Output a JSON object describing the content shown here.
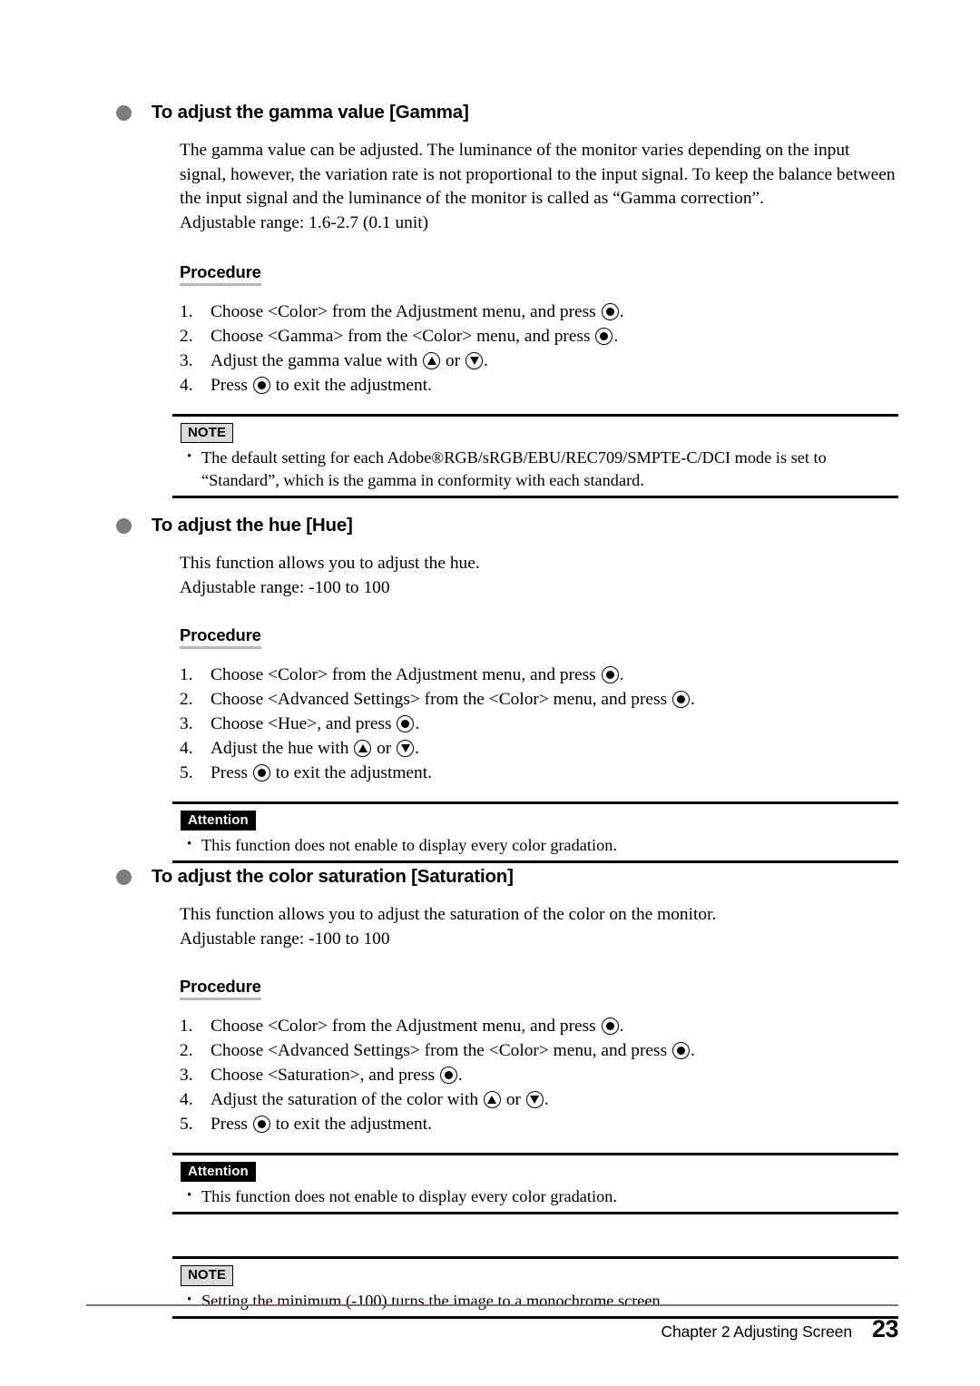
{
  "document": {
    "page_number": "23",
    "footer_text": "Chapter 2  Adjusting Screen"
  },
  "sections": [
    {
      "id": "gamma",
      "title": "To adjust the gamma value [Gamma]",
      "paragraphs": [
        "The gamma value can be adjusted. The luminance of the monitor varies depending on the input signal, however, the variation rate is not proportional to the input signal. To keep the balance between the input signal and the luminance of the monitor is called as “Gamma correction”.",
        "Adjustable range: 1.6-2.7 (0.1 unit)"
      ],
      "procedure_label": "Procedure",
      "steps": [
        {
          "num": "1.",
          "before": "Choose <Color> from the Adjustment menu, and press ",
          "key": "enter",
          "after": "."
        },
        {
          "num": "2.",
          "before": "Choose <Gamma> from the <Color> menu, and press ",
          "key": "enter",
          "after": "."
        },
        {
          "num": "3.",
          "before": "Adjust the gamma value with ",
          "key": "up",
          "mid": " or ",
          "key2": "down",
          "after": "."
        },
        {
          "num": "4.",
          "before": "Press ",
          "key": "enter",
          "after": " to exit the adjustment."
        }
      ],
      "callouts": [
        {
          "type": "note",
          "badge": "NOTE",
          "items": [
            "The default setting for each Adobe®RGB/sRGB/EBU/REC709/SMPTE-C/DCI mode is set to “Standard”, which is the gamma in conformity with each standard."
          ]
        }
      ]
    },
    {
      "id": "hue",
      "title": "To adjust the hue [Hue]",
      "paragraphs": [
        "This function allows you to adjust the hue.",
        "Adjustable range: -100 to 100"
      ],
      "procedure_label": "Procedure",
      "steps": [
        {
          "num": "1.",
          "before": "Choose <Color> from the Adjustment menu, and press ",
          "key": "enter",
          "after": "."
        },
        {
          "num": "2.",
          "before": "Choose <Advanced Settings> from the <Color> menu, and press ",
          "key": "enter",
          "after": "."
        },
        {
          "num": "3.",
          "before": "Choose <Hue>, and press ",
          "key": "enter",
          "after": "."
        },
        {
          "num": "4.",
          "before": "Adjust the hue with ",
          "key": "up",
          "mid": " or ",
          "key2": "down",
          "after": "."
        },
        {
          "num": "5.",
          "before": "Press ",
          "key": "enter",
          "after": " to exit the adjustment."
        }
      ],
      "callouts": [
        {
          "type": "attention",
          "badge": "Attention",
          "items": [
            "This function does not enable to display every color gradation."
          ]
        }
      ]
    },
    {
      "id": "saturation",
      "title": "To adjust the color saturation [Saturation]",
      "paragraphs": [
        "This function allows you to adjust the saturation of the color on the monitor.",
        "Adjustable range: -100 to 100"
      ],
      "procedure_label": "Procedure",
      "steps": [
        {
          "num": "1.",
          "before": "Choose <Color> from the Adjustment menu, and press ",
          "key": "enter",
          "after": "."
        },
        {
          "num": "2.",
          "before": "Choose <Advanced Settings> from the <Color> menu, and press ",
          "key": "enter",
          "after": "."
        },
        {
          "num": "3.",
          "before": "Choose <Saturation>, and press ",
          "key": "enter",
          "after": "."
        },
        {
          "num": "4.",
          "before": "Adjust the saturation of the color with ",
          "key": "up",
          "mid": " or ",
          "key2": "down",
          "after": "."
        },
        {
          "num": "5.",
          "before": "Press ",
          "key": "enter",
          "after": " to exit the adjustment."
        }
      ],
      "callouts": [
        {
          "type": "attention",
          "badge": "Attention",
          "items": [
            "This function does not enable to display every color gradation."
          ]
        },
        {
          "type": "note",
          "badge": "NOTE",
          "items": [
            "Setting the minimum (-100) turns the image to a monochrome screen."
          ]
        }
      ]
    }
  ],
  "icons": {
    "enter": "enter-key-icon",
    "up": "up-key-icon",
    "down": "down-key-icon",
    "bullet": "section-bullet-icon"
  },
  "colors": {
    "bullet": "#7d7d7d",
    "footer_rule": "#8a6f6f",
    "note_badge_bg": "#d9d9d9",
    "attention_badge_bg": "#000000",
    "procedure_underline": "#b8b8b8"
  }
}
